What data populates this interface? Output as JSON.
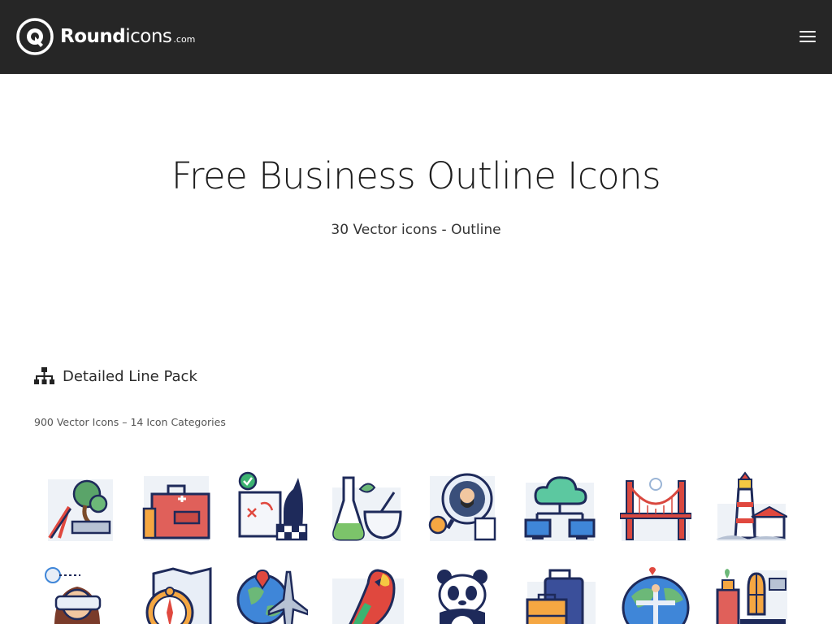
{
  "site": {
    "brand_bold": "Round",
    "brand_light": "icons",
    "brand_tld": ".com",
    "logo_icon": "roundicons-logo-icon",
    "menu_icon": "hamburger-menu-icon",
    "header_bg": "#262626"
  },
  "hero": {
    "title": "Free Business Outline Icons",
    "subtitle": "30 Vector icons - Outline"
  },
  "pack": {
    "icon": "sitemap-icon",
    "title": "Detailed Line Pack",
    "subtitle": "900 Vector Icons – 14 Icon Categories"
  },
  "icons": [
    {
      "name": "bonsai-scissors-icon"
    },
    {
      "name": "first-aid-kit-icon"
    },
    {
      "name": "chess-strategy-board-icon"
    },
    {
      "name": "lab-flask-mortar-icon"
    },
    {
      "name": "person-search-icon"
    },
    {
      "name": "cloud-network-icon"
    },
    {
      "name": "golden-gate-bridge-icon"
    },
    {
      "name": "lighthouse-icon"
    },
    {
      "name": "vr-headset-woman-icon"
    },
    {
      "name": "map-compass-icon"
    },
    {
      "name": "globe-airplane-icon"
    },
    {
      "name": "parrot-icon"
    },
    {
      "name": "panda-icon"
    },
    {
      "name": "luggage-travel-icon"
    },
    {
      "name": "world-statue-icon"
    },
    {
      "name": "cafe-window-icon"
    }
  ]
}
